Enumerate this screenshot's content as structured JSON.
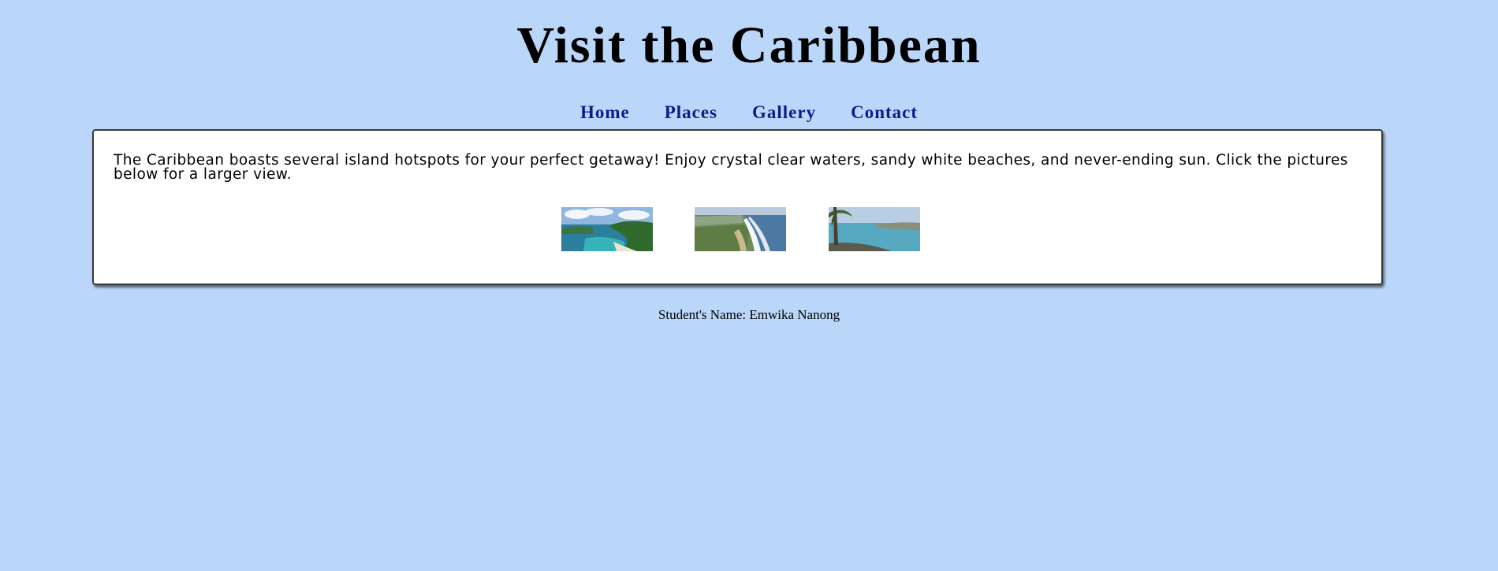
{
  "header": {
    "title": "Visit the Caribbean"
  },
  "nav": {
    "items": [
      {
        "label": "Home"
      },
      {
        "label": "Places"
      },
      {
        "label": "Gallery"
      },
      {
        "label": "Contact"
      }
    ],
    "link_color": "#0b1b8c"
  },
  "main": {
    "intro": "The Caribbean boasts several island hotspots for your perfect getaway! Enjoy crystal clear waters, sandy white beaches, and never-ending sun. Click the pictures below for a larger view.",
    "thumbnails": [
      {
        "subject": "turquoise bay with green hills under cloudy sky"
      },
      {
        "subject": "coastal cliff with green fields and ocean surf"
      },
      {
        "subject": "palm tree over calm turquoise beach"
      }
    ]
  },
  "footer": {
    "text": "Student's Name: Emwika Nanong"
  },
  "colors": {
    "background": "#bad6f9",
    "panel": "#ffffff",
    "text": "#000000"
  }
}
